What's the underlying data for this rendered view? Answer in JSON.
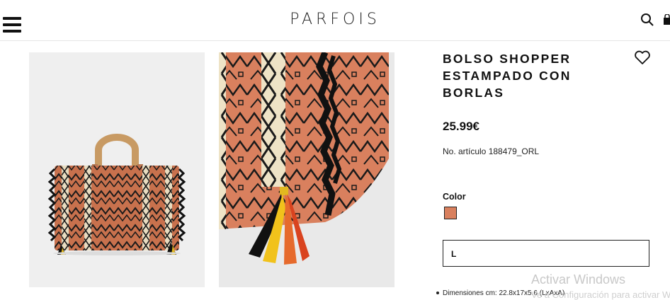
{
  "header": {
    "brand": "PARFOIS"
  },
  "product": {
    "title_lines": [
      "BOLSO SHOPPER",
      "ESTAMPADO CON",
      "BORLAS"
    ],
    "price": "25.99€",
    "reference": "No. artículo 188479_ORL",
    "color_label": "Color",
    "selected_color": "#d9805e",
    "size": "L",
    "dimensions": "Dimensiones cm: 22.8x17x5.6 (LxAxA)"
  },
  "watermark": {
    "line1": "Activar Windows",
    "line2": "Ve a Configuración para activar Windows."
  },
  "icons": {
    "menu": "menu-icon",
    "search": "search-icon",
    "bag": "bag-icon",
    "wishlist": "heart-icon"
  }
}
